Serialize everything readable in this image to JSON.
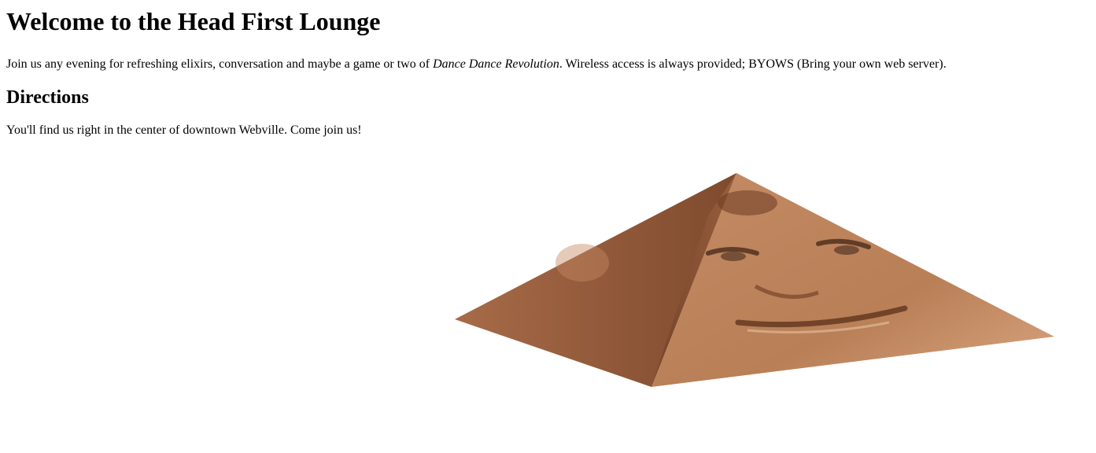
{
  "page": {
    "heading": "Welcome to the Head First Lounge",
    "intro_before": "Join us any evening for refreshing elixirs, conversation and maybe a game or two of ",
    "intro_emphasis": "Dance Dance Revolution",
    "intro_after": ". Wireless access is always provided; BYOWS (Bring your own web server).",
    "directions_heading": "Directions",
    "directions_text": "You'll find us right in the center of downtown Webville. Come join us!"
  },
  "image": {
    "subject": "rotating textured pyramid",
    "colors": {
      "face_left": "#9a5c3a",
      "face_front_left": "#8a5234",
      "face_front_right": "#b47b55",
      "face_right": "#c79069"
    }
  }
}
